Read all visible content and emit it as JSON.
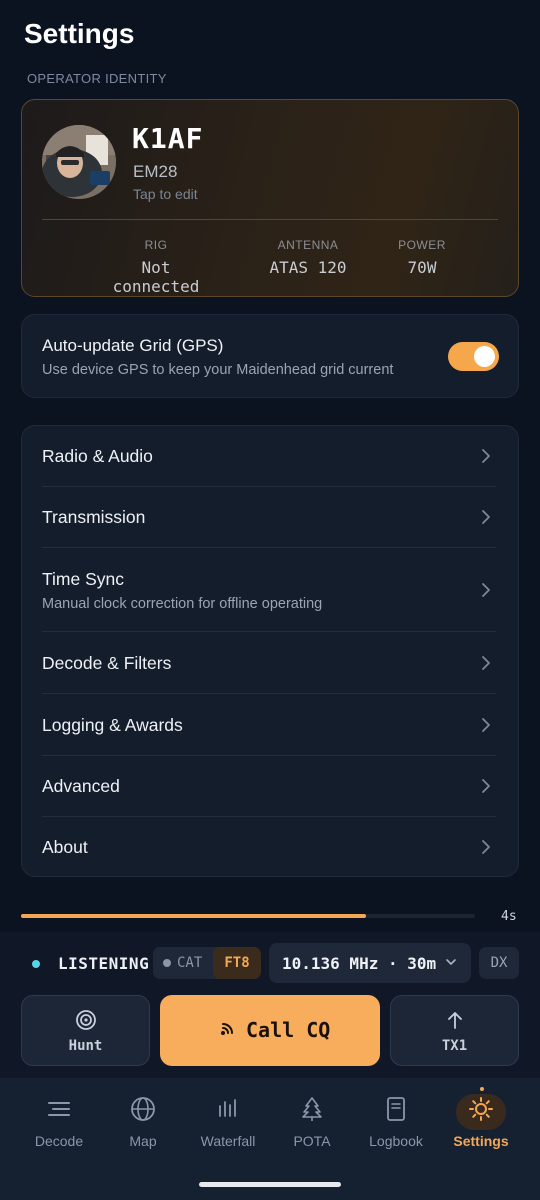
{
  "header": {
    "title": "Settings"
  },
  "identity": {
    "section_label": "OPERATOR IDENTITY",
    "callsign": "K1AF",
    "grid": "EM28",
    "edit_hint": "Tap to edit",
    "stats": [
      {
        "label": "RIG",
        "value": "Not connected"
      },
      {
        "label": "ANTENNA",
        "value": "ATAS 120"
      },
      {
        "label": "POWER",
        "value": "70W"
      }
    ]
  },
  "gps": {
    "title": "Auto-update Grid (GPS)",
    "subtitle": "Use device GPS to keep your Maidenhead grid current",
    "enabled": true
  },
  "menu": {
    "items": [
      {
        "label": "Radio & Audio"
      },
      {
        "label": "Transmission"
      },
      {
        "label": "Time Sync",
        "subtitle": "Manual clock correction for offline operating"
      },
      {
        "label": "Decode & Filters"
      },
      {
        "label": "Logging & Awards"
      },
      {
        "label": "Advanced"
      },
      {
        "label": "About"
      }
    ]
  },
  "cycle": {
    "progress": 0.76,
    "remaining": "4s"
  },
  "status": {
    "state": "LISTENING",
    "cat": "CAT",
    "mode": "FT8",
    "frequency": "10.136 MHz · 30m",
    "dx": "DX"
  },
  "actions": {
    "hunt": "Hunt",
    "call_cq": "Call CQ",
    "tx1": "TX1"
  },
  "nav": {
    "items": [
      {
        "label": "Decode",
        "icon": "decode-icon"
      },
      {
        "label": "Map",
        "icon": "globe-icon"
      },
      {
        "label": "Waterfall",
        "icon": "waterfall-icon"
      },
      {
        "label": "POTA",
        "icon": "tree-icon"
      },
      {
        "label": "Logbook",
        "icon": "book-icon"
      },
      {
        "label": "Settings",
        "icon": "sun-gear-icon"
      }
    ],
    "active": "Settings"
  },
  "colors": {
    "accent": "#f4a855",
    "background": "#0b1220",
    "card": "#141d2c",
    "listening": "#58d4e6"
  }
}
